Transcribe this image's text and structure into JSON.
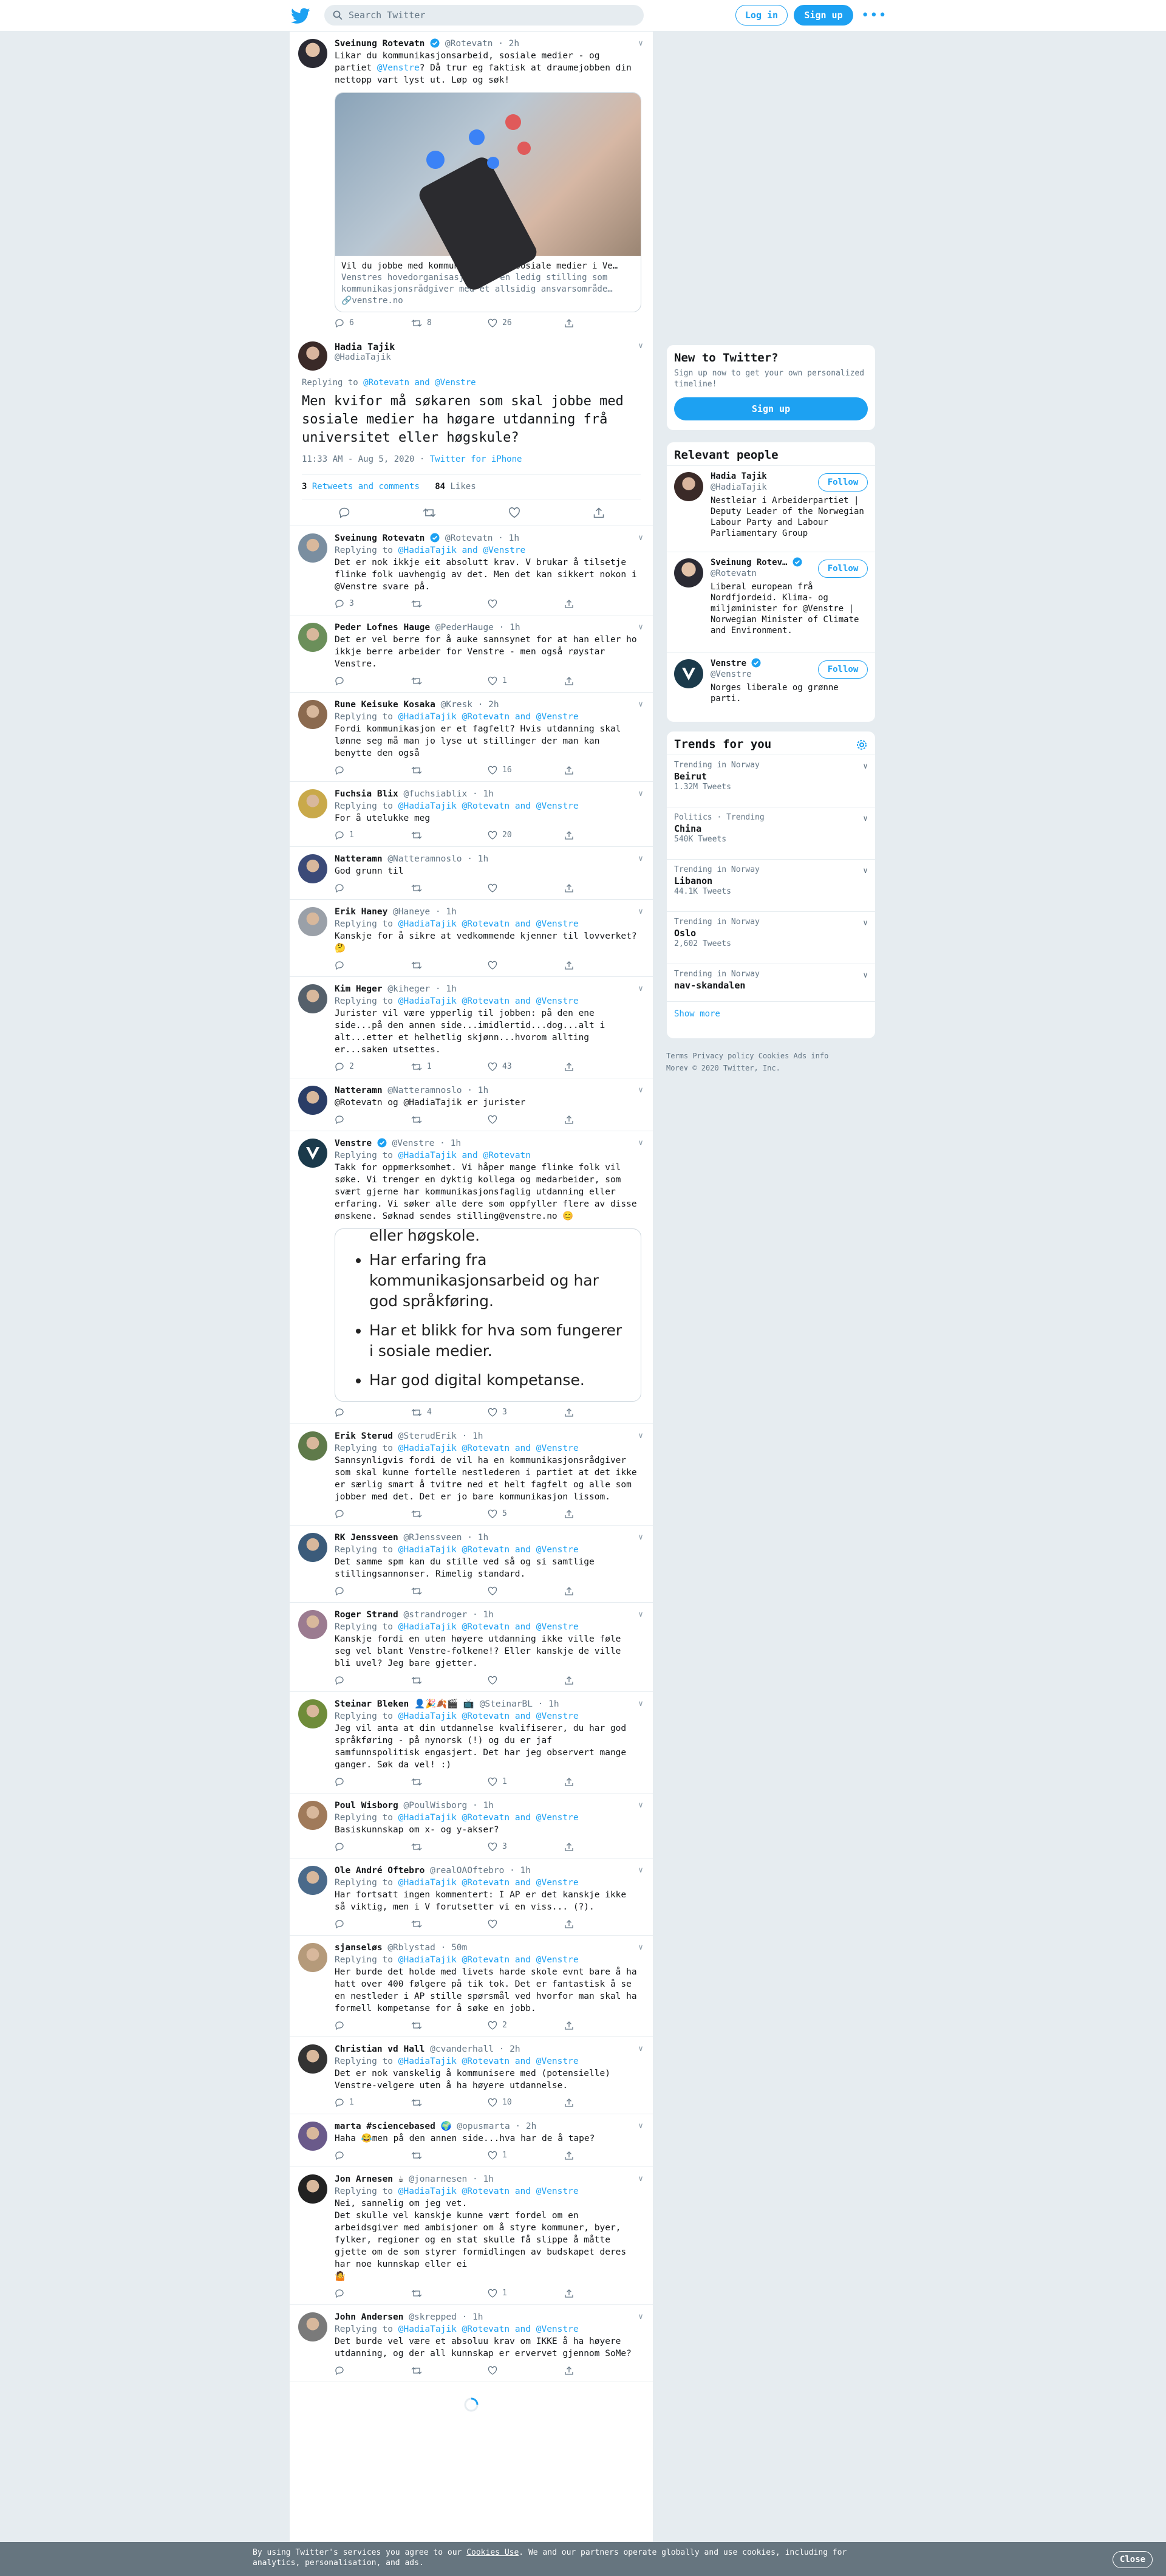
{
  "header": {
    "search_placeholder": "Search Twitter",
    "login": "Log in",
    "signup": "Sign up"
  },
  "parent_tweet": {
    "name": "Sveinung Rotevatn",
    "handle": "@Rotevatn",
    "time": "· 2h",
    "text_pre": "Likar du kommunikasjonsarbeid, sosiale medier - og partiet ",
    "mention": "@Venstre",
    "text_post": "? Då trur eg faktisk at draumejobben din nettopp vart lyst ut. Løp og søk!",
    "card_title": "Vil du jobbe med kommunikasjon og sosiale medier i Ve…",
    "card_desc": "Venstres hovedorganisasjon har en ledig stilling som kommunikasjonsrådgiver med et allsidig ansvarsområde…",
    "card_domain": "🔗venstre.no",
    "replies": "6",
    "retweets": "8",
    "likes": "26"
  },
  "main_tweet": {
    "name": "Hadia Tajik",
    "handle": "@HadiaTajik",
    "replying_label": "Replying to ",
    "replying_to": "@Rotevatn and @Venstre",
    "text": "Men kvifor må søkaren som skal jobbe med sosiale medier ha høgare utdanning frå universitet eller høgskule?",
    "timestamp": "11:33 AM - Aug 5, 2020 · ",
    "client": "Twitter for iPhone",
    "retweets_count": "3",
    "retweets_label": "Retweets and comments",
    "likes_count": "84",
    "likes_label": "Likes"
  },
  "replies": [
    {
      "name": "Sveinung Rotevatn",
      "verified": true,
      "handle": "@Rotevatn · 1h",
      "reply_to": "@HadiaTajik and @Venstre",
      "text": "Det er nok ikkje eit absolutt krav. V brukar å tilsetje flinke folk uavhengig av det. Men det kan sikkert nokon i @Venstre svare på.",
      "r": "3",
      "rt": "",
      "l": ""
    },
    {
      "name": "Peder Lofnes Hauge",
      "verified": false,
      "handle": "@PederHauge · 1h",
      "reply_to": "",
      "text": "Det er vel berre for å auke sannsynet for at han eller ho ikkje berre arbeider for Venstre - men også røystar Venstre.",
      "r": "",
      "rt": "",
      "l": "1"
    },
    {
      "name": "Rune Keisuke Kosaka",
      "verified": false,
      "handle": "@Kresk · 2h",
      "reply_to": "@HadiaTajik @Rotevatn and @Venstre",
      "text": "Fordi kommunikasjon er et fagfelt? Hvis utdanning skal lønne seg må man jo lyse ut stillinger der man kan benytte den også",
      "r": "",
      "rt": "",
      "l": "16"
    },
    {
      "name": "Fuchsia Blix",
      "verified": false,
      "handle": "@fuchsiablix · 1h",
      "reply_to": "@HadiaTajik @Rotevatn and @Venstre",
      "text": "For å utelukke meg",
      "r": "1",
      "rt": "",
      "l": "20"
    },
    {
      "name": "Natteramn",
      "verified": false,
      "handle": "@Natteramnoslo · 1h",
      "reply_to": "",
      "text": "God grunn til",
      "r": "",
      "rt": "",
      "l": ""
    },
    {
      "name": "Erik Haney",
      "verified": false,
      "handle": "@Haneye · 1h",
      "reply_to": "@HadiaTajik @Rotevatn and @Venstre",
      "text": "Kanskje for å sikre at vedkommende kjenner til lovverket? 🤔",
      "r": "",
      "rt": "",
      "l": ""
    },
    {
      "name": "Kim Heger",
      "verified": false,
      "handle": "@kiheger · 1h",
      "reply_to": "@HadiaTajik @Rotevatn and @Venstre",
      "text": "Jurister vil være ypperlig til jobben: på den ene side...på den annen side...imidlertid...dog...alt i alt...etter et helhetlig skjønn...hvorom allting er...saken utsettes.",
      "r": "2",
      "rt": "1",
      "l": "43"
    },
    {
      "name": "Natteramn",
      "verified": false,
      "handle": "@Natteramnoslo · 1h",
      "reply_to": "",
      "text": "@Rotevatn og @HadiaTajik er jurister",
      "r": "",
      "rt": "",
      "l": ""
    }
  ],
  "venstre_reply": {
    "name": "Venstre",
    "handle": "@Venstre · 1h",
    "reply_to": "@HadiaTajik and @Rotevatn",
    "text": "Takk for oppmerksomhet. Vi håper mange flinke folk vil søke. Vi trenger en dyktig kollega og medarbeider, som svært gjerne har kommunikasjonsfaglig utdanning eller erfaring. Vi søker alle dere som oppfyller flere av disse ønskene. Søknad sendes stilling@venstre.no 😊",
    "image_items": [
      "eller høgskole.",
      "Har erfaring fra kommunikasjonsarbeid og har god språkføring.",
      "Har et blikk for hva som fungerer i sosiale medier.",
      "Har god digital kompetanse."
    ],
    "r": "",
    "rt": "4",
    "l": "3"
  },
  "replies2": [
    {
      "name": "Erik Sterud",
      "handle": "@SterudErik · 1h",
      "reply_to": "@HadiaTajik @Rotevatn and @Venstre",
      "text": "Sannsynligvis fordi de vil ha en kommunikasjonsrådgiver som skal kunne fortelle nestlederen i partiet at det ikke er særlig smart å tvitre ned et helt fagfelt og alle som jobber med det. Det er jo bare kommunikasjon lissom.",
      "r": "",
      "rt": "",
      "l": "5"
    },
    {
      "name": "RK Jenssveen",
      "handle": "@RJenssveen · 1h",
      "reply_to": "@HadiaTajik @Rotevatn and @Venstre",
      "text": "Det samme spm kan du stille ved så og si samtlige stillingsannonser. Rimelig standard.",
      "r": "",
      "rt": "",
      "l": ""
    },
    {
      "name": "Roger Strand",
      "handle": "@strandroger · 1h",
      "reply_to": "@HadiaTajik @Rotevatn and @Venstre",
      "text": "Kanskje fordi en uten høyere utdanning ikke ville føle seg vel blant Venstre-folkene!? Eller kanskje de ville bli uvel? Jeg bare gjetter.",
      "r": "",
      "rt": "",
      "l": ""
    },
    {
      "name": "Steinar Bleken 👤🎉🍂🎬 📺",
      "handle": "@SteinarBL · 1h",
      "reply_to": "@HadiaTajik @Rotevatn and @Venstre",
      "text": "Jeg vil anta at din utdannelse kvalifiserer, du har god språkføring - på nynorsk (!) og du er jaf samfunnspolitisk engasjert. Det har jeg observert mange ganger. Søk da vel! :)",
      "r": "",
      "rt": "",
      "l": "1"
    },
    {
      "name": "Poul Wisborg",
      "handle": "@PoulWisborg · 1h",
      "reply_to": "@HadiaTajik @Rotevatn and @Venstre",
      "text": "Basiskunnskap om x- og y-akser?",
      "r": "",
      "rt": "",
      "l": "3"
    },
    {
      "name": "Ole André Oftebro",
      "handle": "@realOAOftebro · 1h",
      "reply_to": "@HadiaTajik @Rotevatn and @Venstre",
      "text": "Har fortsatt ingen kommentert: I AP er det kanskje ikke så viktig, men i V forutsetter vi en viss... (?).",
      "r": "",
      "rt": "",
      "l": ""
    },
    {
      "name": "sjanseløs",
      "handle": "@Rblystad · 50m",
      "reply_to": "@HadiaTajik @Rotevatn and @Venstre",
      "text": "Her burde det holde med livets harde skole evnt bare å ha hatt over 400 følgere på tik tok. Det er fantastisk å se en nestleder i AP stille spørsmål ved hvorfor man skal ha formell kompetanse for å søke en jobb.",
      "r": "",
      "rt": "",
      "l": "2"
    },
    {
      "name": "Christian vd Hall",
      "handle": "@cvanderhall · 2h",
      "reply_to": "@HadiaTajik @Rotevatn and @Venstre",
      "text": "Det er nok vanskelig å kommunisere med (potensielle) Venstre-velgere uten å ha høyere utdannelse.",
      "r": "1",
      "rt": "",
      "l": "10"
    },
    {
      "name": "marta #sciencebased 🌍",
      "handle": "@opusmarta · 2h",
      "reply_to": "",
      "text": "Haha 😂men på den annen side...hva har de å tape?",
      "r": "",
      "rt": "",
      "l": "1"
    },
    {
      "name": "Jon Arnesen ☕",
      "handle": "@jonarnesen · 1h",
      "reply_to": "@HadiaTajik @Rotevatn and @Venstre",
      "text": "Nei, sannelig om jeg vet.\nDet skulle vel kanskje kunne vært fordel om en arbeidsgiver med ambisjoner om å styre kommuner, byer, fylker, regioner og en stat skulle få slippe å måtte gjette om de som styrer formidlingen av budskapet deres har noe kunnskap eller ei\n🤷",
      "r": "",
      "rt": "",
      "l": "1"
    },
    {
      "name": "John Andersen",
      "handle": "@skrepped · 1h",
      "reply_to": "@HadiaTajik @Rotevatn and @Venstre",
      "text": "Det burde vel være et absoluu krav om IKKE å ha høyere utdanning, og der all kunnskap er ervervet gjennom SoMe?",
      "r": "",
      "rt": "",
      "l": ""
    }
  ],
  "new_to_twitter": {
    "title": "New to Twitter?",
    "text": "Sign up now to get your own personalized timeline!",
    "button": "Sign up"
  },
  "relevant": {
    "title": "Relevant people",
    "people": [
      {
        "name": "Hadia Tajik",
        "handle": "@HadiaTajik",
        "bio": "Nestleiar i Arbeiderpartiet | Deputy Leader of the Norwegian Labour Party and Labour Parliamentary Group",
        "follow": "Follow"
      },
      {
        "name": "Sveinung Rotev…",
        "handle": "@Rotevatn",
        "bio": "Liberal european frå Nordfjordeid. Klima- og miljøminister for @Venstre | Norwegian Minister of Climate and Environment.",
        "follow": "Follow"
      },
      {
        "name": "Venstre",
        "handle": "@Venstre",
        "bio": "Norges liberale og grønne parti.",
        "follow": "Follow"
      }
    ]
  },
  "trends": {
    "title": "Trends for you",
    "items": [
      {
        "cat": "Trending in Norway",
        "name": "Beirut",
        "count": "1.32M Tweets"
      },
      {
        "cat": "Politics · Trending",
        "name": "China",
        "count": "540K Tweets"
      },
      {
        "cat": "Trending in Norway",
        "name": "Libanon",
        "count": "44.1K Tweets"
      },
      {
        "cat": "Trending in Norway",
        "name": "Oslo",
        "count": "2,602 Tweets"
      },
      {
        "cat": "Trending in Norway",
        "name": "nav-skandalen",
        "count": ""
      }
    ],
    "show_more": "Show more"
  },
  "footer": {
    "links": "Terms  Privacy policy  Cookies  Ads info",
    "more": "More∨  © 2020 Twitter, Inc."
  },
  "cookie": {
    "text_pre": "By using Twitter's services you agree to our ",
    "link": "Cookies Use",
    "text_post": ". We and our partners operate globally and use cookies, including for analytics, personalisation, and ads.",
    "close": "Close"
  },
  "colors": {
    "accent": "#1da1f2",
    "bg": "#e6ecf0",
    "text": "#14171a",
    "muted": "#657786"
  }
}
